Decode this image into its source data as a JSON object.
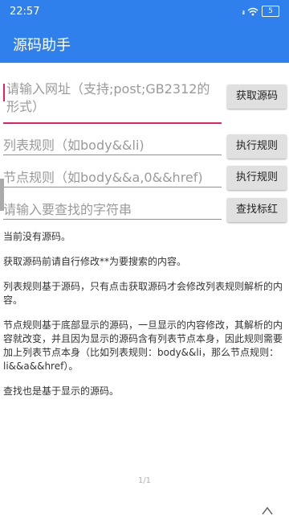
{
  "status_bar": {
    "time": "22:57",
    "battery": "5",
    "icons": [
      "wifi-icon",
      "signal-icon",
      "battery-icon"
    ]
  },
  "app_bar": {
    "title": "源码助手"
  },
  "url_input": {
    "placeholder": "请输入网址（支持;post;GB2312的形式）",
    "value": ""
  },
  "list_rule_input": {
    "placeholder": "列表规则（如body&&li)",
    "value": ""
  },
  "node_rule_input": {
    "placeholder": "节点规则（如body&&a,0&&href)",
    "value": ""
  },
  "search_input": {
    "placeholder": "请输入要查找的字符串",
    "value": ""
  },
  "buttons": {
    "fetch_source": "获取源码",
    "run_rule_1": "执行规则",
    "run_rule_2": "执行规则",
    "find_highlight": "查找标红"
  },
  "content": {
    "lines": [
      "当前没有源码。",
      "获取源码前请自行修改**为要搜索的内容。",
      "列表规则基于源码，只有点击获取源码才会修改列表规则解析的内容。",
      "节点规则基于底部显示的源码，一旦显示的内容修改，其解析的内容就改变，并且因为显示的源码含有列表节点本身，因此规则需要加上列表节点本身（比如列表规则：body&&li，那么节点规则：li&&a&&href）。",
      "查找也是基于显示的源码。"
    ]
  },
  "page_indicator": "1/1",
  "colors": {
    "primary": "#2f80ed",
    "accent": "#e91e63",
    "button_bg": "#e0e0e0"
  }
}
